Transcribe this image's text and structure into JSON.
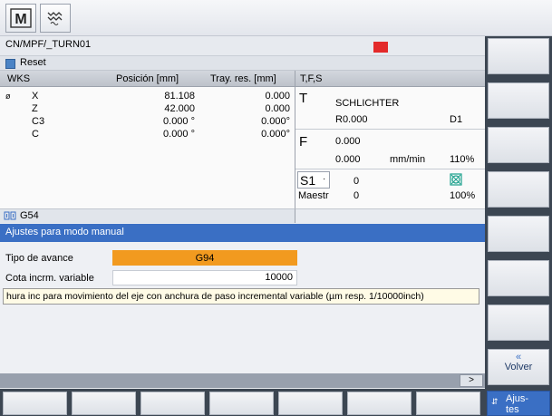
{
  "top": {
    "icons": [
      "machine-m-icon",
      "sinumerik-wave-icon"
    ]
  },
  "status": {
    "path": "CN/MPF/_TURN01",
    "reset_label": "Reset",
    "stop_color": "#e32a2a"
  },
  "wks": {
    "header": {
      "wks": "WKS",
      "position": "Posición [mm]",
      "residual": "Tray. res. [mm]"
    },
    "axes": [
      {
        "marker": "ø",
        "name": "X",
        "position": "81.108",
        "residual": "0.000"
      },
      {
        "marker": "",
        "name": "Z",
        "position": "42.000",
        "residual": "0.000"
      },
      {
        "marker": "",
        "name": "C3",
        "position": "0.000 °",
        "residual": "0.000°"
      },
      {
        "marker": "",
        "name": "C",
        "position": "0.000 °",
        "residual": "0.000°"
      }
    ],
    "work_offset": "G54"
  },
  "tfs": {
    "header": "T,F,S",
    "t_letter": "T",
    "tool_name": "SCHLICHTER",
    "tool_r": "R0.000",
    "tool_d": "D1",
    "f_letter": "F",
    "feed_value": "0.000",
    "feed_actual": "0.000",
    "feed_unit": "mm/min",
    "feed_override": "110%",
    "spindle_label": "S1",
    "spindle_value": "0",
    "spindle_sub_label": "Maestr",
    "spindle_sub_value": "0",
    "spindle_override": "100%"
  },
  "dialog": {
    "title": "Ajustes para modo manual",
    "feed_type_label": "Tipo de avance",
    "feed_type_value": "G94",
    "incr_label": "Cota incrm. variable",
    "incr_value": "10000",
    "tooltip": "hura inc para movimiento del eje con anchura de paso incremental variable (µm resp. 1/10000inch)"
  },
  "scroll": {
    "right_arrow": ">"
  },
  "softkeys": {
    "volver_arrow": "«",
    "volver": "Volver",
    "ajustes_line1": "Ajus-",
    "ajustes_line2": "tes"
  },
  "colors": {
    "accent": "#3a6fc4",
    "feed_highlight": "#f29a1f",
    "spindle_icon": "#1aa08c"
  }
}
